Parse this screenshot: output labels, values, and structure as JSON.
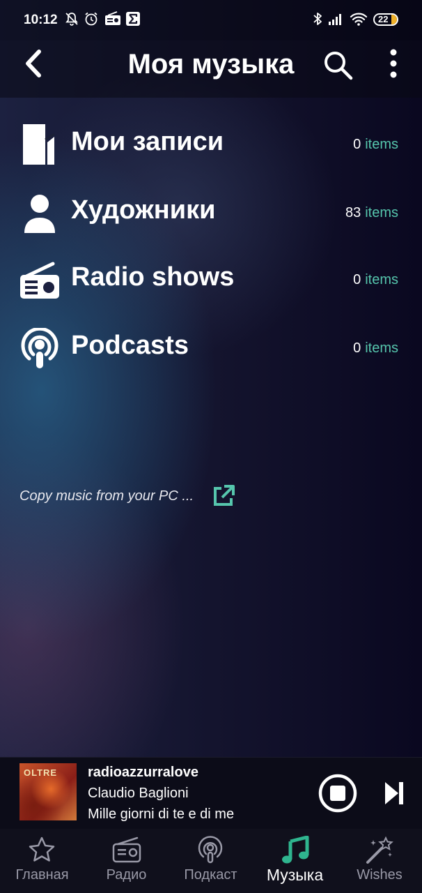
{
  "status_bar": {
    "time": "10:12",
    "battery": "22"
  },
  "header": {
    "title": "Моя музыка"
  },
  "library": {
    "items": [
      {
        "label": "Мои записи",
        "count": "0",
        "unit": "items",
        "icon": "document-icon"
      },
      {
        "label": "Художники",
        "count": "83",
        "unit": "items",
        "icon": "person-icon"
      },
      {
        "label": "Radio shows",
        "count": "0",
        "unit": "items",
        "icon": "radio-icon"
      },
      {
        "label": "Podcasts",
        "count": "0",
        "unit": "items",
        "icon": "podcast-icon"
      }
    ],
    "copy_link": "Copy music from your PC ..."
  },
  "player": {
    "station": "radioazzurralove",
    "artist": "Claudio Baglioni",
    "track": "Mille giorni di te e di me",
    "art_text": "OLTRE"
  },
  "nav": {
    "tabs": [
      {
        "label": "Главная",
        "icon": "star-icon"
      },
      {
        "label": "Радио",
        "icon": "radio-icon"
      },
      {
        "label": "Подкаст",
        "icon": "podcast-icon"
      },
      {
        "label": "Музыка",
        "icon": "music-note-icon",
        "active": true
      },
      {
        "label": "Wishes",
        "icon": "magic-wand-icon"
      }
    ]
  },
  "colors": {
    "accent": "#56c6ad",
    "background": "#14142e",
    "nav_bg": "#10101c"
  }
}
